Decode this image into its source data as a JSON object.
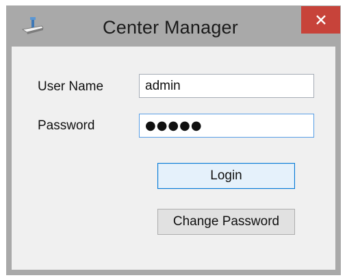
{
  "window": {
    "title": "Center Manager",
    "close_glyph": "✕"
  },
  "form": {
    "username_label": "User Name",
    "username_value": "admin",
    "password_label": "Password",
    "password_mask": "●●●●●",
    "login_label": "Login",
    "change_password_label": "Change Password"
  },
  "icons": {
    "app": "app-icon",
    "close": "close-icon"
  },
  "colors": {
    "frame": "#a9a9a9",
    "client_background": "#f0f0f0",
    "close_button": "#c7433a",
    "focus_border": "#569de5",
    "default_button_border": "#0078d7"
  }
}
